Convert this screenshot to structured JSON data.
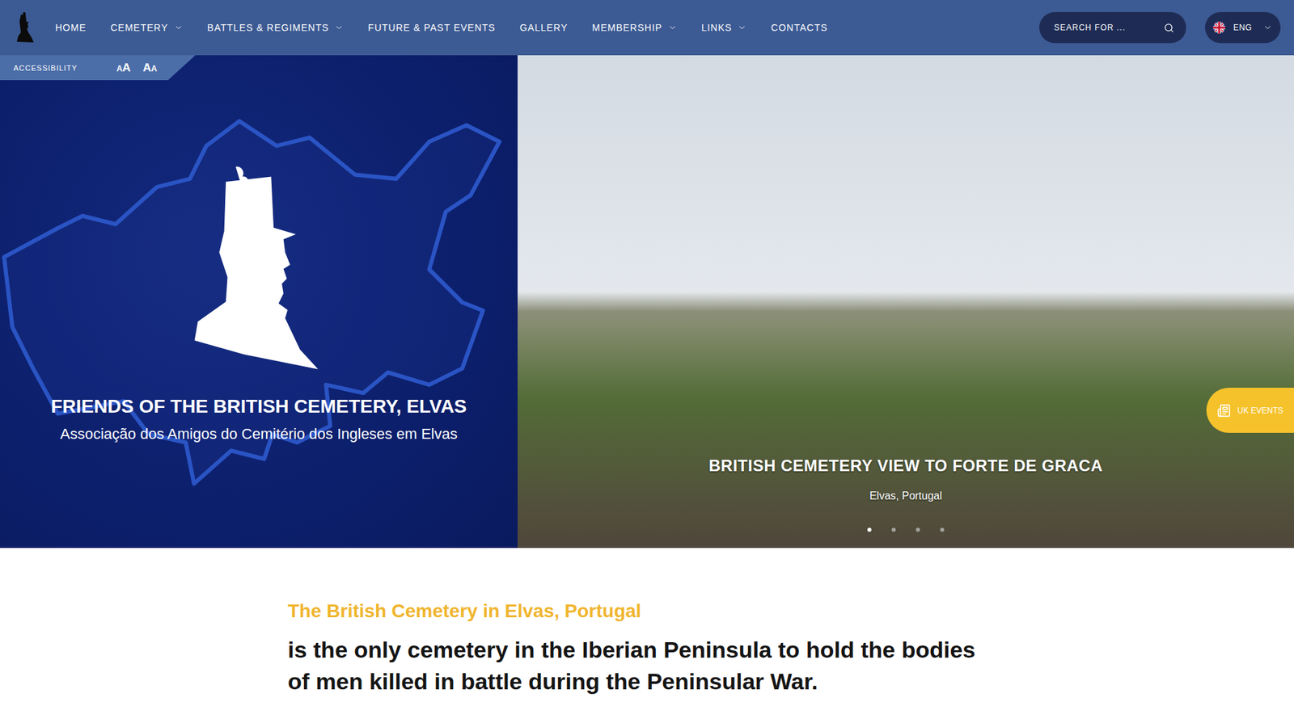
{
  "nav": {
    "items": [
      {
        "label": "HOME",
        "has_dropdown": false
      },
      {
        "label": "CEMETERY",
        "has_dropdown": true
      },
      {
        "label": "BATTLES & REGIMENTS",
        "has_dropdown": true
      },
      {
        "label": "FUTURE & PAST EVENTS",
        "has_dropdown": false
      },
      {
        "label": "GALLERY",
        "has_dropdown": false
      },
      {
        "label": "MEMBERSHIP",
        "has_dropdown": true
      },
      {
        "label": "LINKS",
        "has_dropdown": true
      },
      {
        "label": "CONTACTS",
        "has_dropdown": false
      }
    ]
  },
  "search": {
    "placeholder": "SEARCH FOR ..."
  },
  "language": {
    "label": "ENG"
  },
  "accessibility": {
    "label": "ACCESSIBILITY",
    "controls": [
      {
        "letters": [
          {
            "text": "A",
            "size": "small"
          },
          {
            "text": "A",
            "size": "large"
          }
        ]
      },
      {
        "letters": [
          {
            "text": "A",
            "size": "large"
          },
          {
            "text": "A",
            "size": "small"
          }
        ]
      }
    ]
  },
  "hero": {
    "title": "FRIENDS OF THE BRITISH CEMETERY, ELVAS",
    "subtitle": "Associação dos Amigos do Cemitério dos Ingleses em Elvas",
    "slide": {
      "title": "BRITISH CEMETERY VIEW TO FORTE DE GRACA",
      "location": "Elvas, Portugal"
    },
    "dots": [
      {
        "selected": true
      },
      {
        "selected": false
      },
      {
        "selected": false
      },
      {
        "selected": false
      }
    ]
  },
  "side_tab": {
    "label": "UK EVENTS"
  },
  "intro": {
    "heading": "The British Cemetery in Elvas, Portugal",
    "text": "is the only cemetery in the Iberian Peninsula to hold the bodies of men killed in battle during the Peninsular War."
  }
}
